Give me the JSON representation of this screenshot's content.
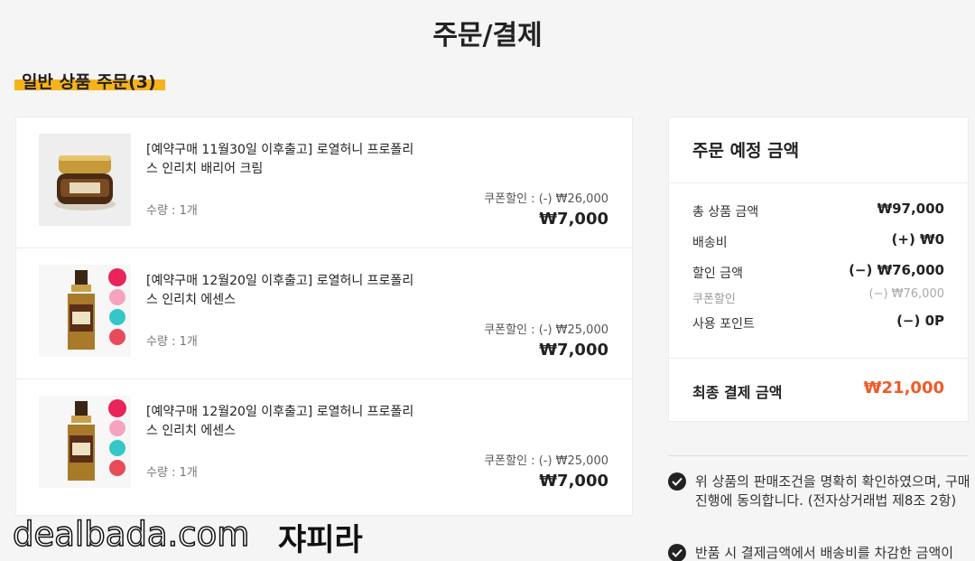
{
  "page": {
    "title": "주문/결제"
  },
  "section": {
    "title": "일반 상품 주문(3)"
  },
  "items": [
    {
      "name": "[예약구매 11월30일 이후출고] 로열허니 프로폴리스 인리치 배리어 크림",
      "quantity": "수량 : 1개",
      "coupon": "쿠폰할인 : (-) ₩26,000",
      "price": "₩7,000",
      "image": "cream-jar"
    },
    {
      "name": "[예약구매 12월20일 이후출고] 로열허니 프로폴리스 인리치 에센스",
      "quantity": "수량 : 1개",
      "coupon": "쿠폰할인 : (-) ₩25,000",
      "price": "₩7,000",
      "image": "essence-bottle"
    },
    {
      "name": "[예약구매 12월20일 이후출고] 로열허니 프로폴리스 인리치 에센스",
      "quantity": "수량 : 1개",
      "coupon": "쿠폰할인 : (-) ₩25,000",
      "price": "₩7,000",
      "image": "essence-bottle"
    }
  ],
  "summary": {
    "title": "주문 예정 금액",
    "rows": [
      {
        "label": "총 상품 금액",
        "value": "₩97,000"
      },
      {
        "label": "배송비",
        "value": "(+) ₩0"
      },
      {
        "label": "할인 금액",
        "value": "(−) ₩76,000"
      },
      {
        "label": "쿠폰할인",
        "value": "(−) ₩76,000"
      },
      {
        "label": "사용 포인트",
        "value": "(−) 0P"
      }
    ],
    "final_label": "최종 결제 금액",
    "final_value": "₩21,000"
  },
  "agreements": [
    {
      "text": "위 상품의 판매조건을 명확히 확인하였으며, 구매 진행에 동의합니다. (전자상거래법 제8조 2항)"
    },
    {
      "text": "반품 시 결제금액에서 배송비를 차감한 금액이"
    }
  ],
  "watermark": {
    "site": "dealbada.com",
    "user": "쟈피라"
  },
  "colors": {
    "accent": "#f7b31a",
    "final_price": "#f05a28"
  }
}
